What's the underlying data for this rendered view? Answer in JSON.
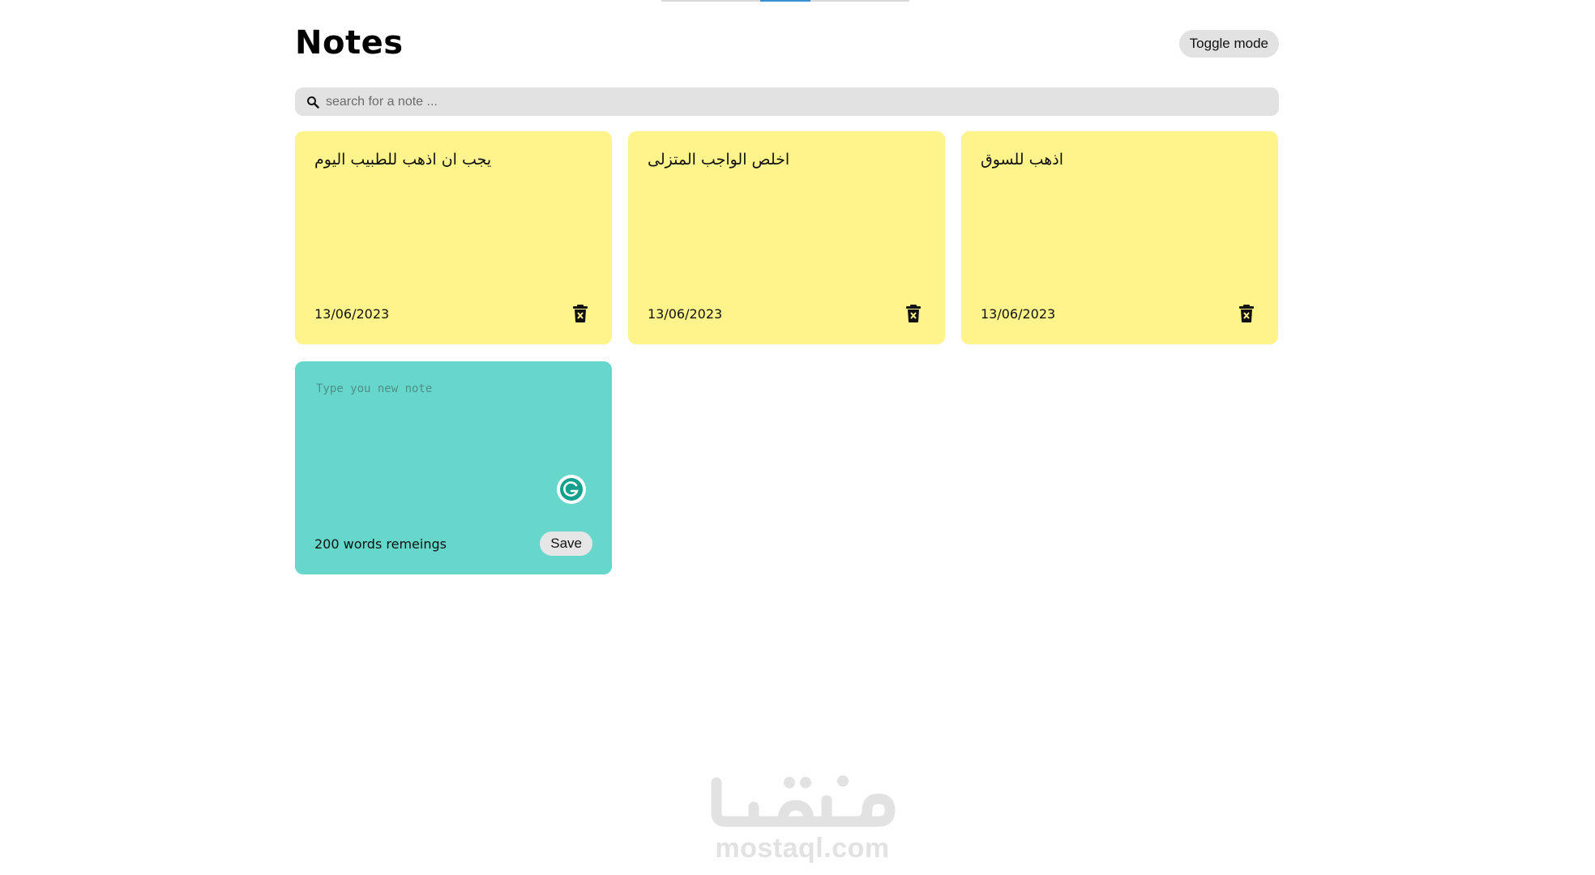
{
  "app": {
    "title": "Notes",
    "toggle_label": "Toggle mode"
  },
  "search": {
    "placeholder": "search for a note ...",
    "value": ""
  },
  "notes": [
    {
      "text": "يجب ان اذهب للطبيب اليوم",
      "date": "13/06/2023"
    },
    {
      "text": "اخلص الواجب المتزلى",
      "date": "13/06/2023"
    },
    {
      "text": "اذهب للسوق",
      "date": "13/06/2023"
    }
  ],
  "new_note": {
    "placeholder": "Type you new note",
    "value": "",
    "words_remaining": "200 words remeings",
    "save_label": "Save"
  },
  "watermark": {
    "logo_text": "مستقل",
    "site": "mostaql.com"
  },
  "icons": {
    "search": "search-icon",
    "delete": "trash-icon",
    "grammarly": "grammarly-icon"
  },
  "colors": {
    "note_bg": "#fef48b",
    "new_note_bg": "#67d7cc",
    "search_bg": "#e2e2e2",
    "button_bg": "#e2e2e2"
  }
}
